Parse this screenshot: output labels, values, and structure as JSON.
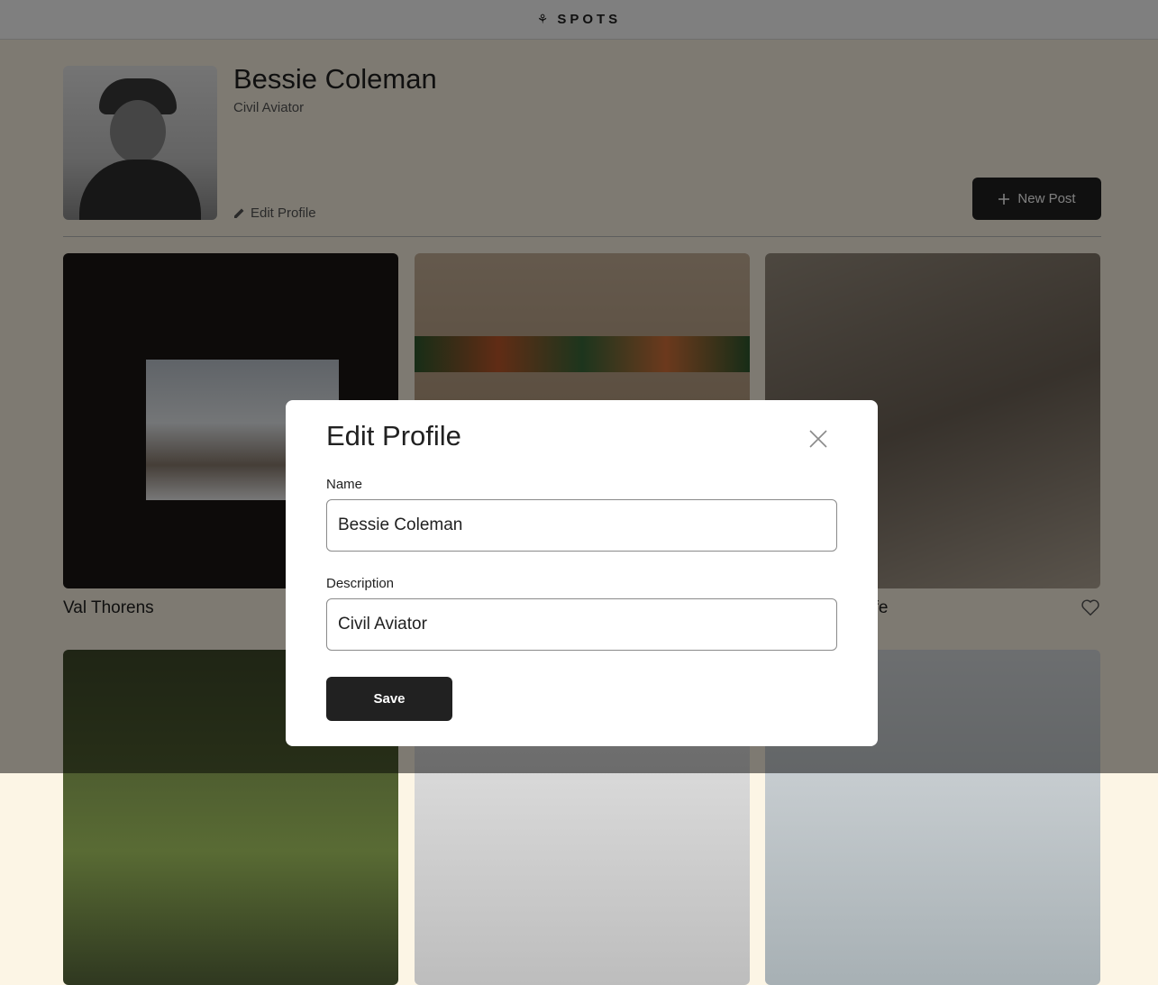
{
  "header": {
    "logo_text": "SPOTS",
    "logo_icon": "sprout-icon"
  },
  "profile": {
    "name": "Bessie Coleman",
    "description": "Civil Aviator",
    "edit_label": "Edit Profile",
    "new_post_label": "New Post"
  },
  "cards": [
    {
      "title": "Val Thorens"
    },
    {
      "title": ""
    },
    {
      "title": "afe"
    }
  ],
  "modal": {
    "title": "Edit Profile",
    "name_label": "Name",
    "name_value": "Bessie Coleman",
    "description_label": "Description",
    "description_value": "Civil Aviator",
    "save_label": "Save"
  },
  "colors": {
    "page_bg": "#fcf5e5",
    "dark": "#212121",
    "overlay": "rgba(0,0,0,0.5)"
  }
}
